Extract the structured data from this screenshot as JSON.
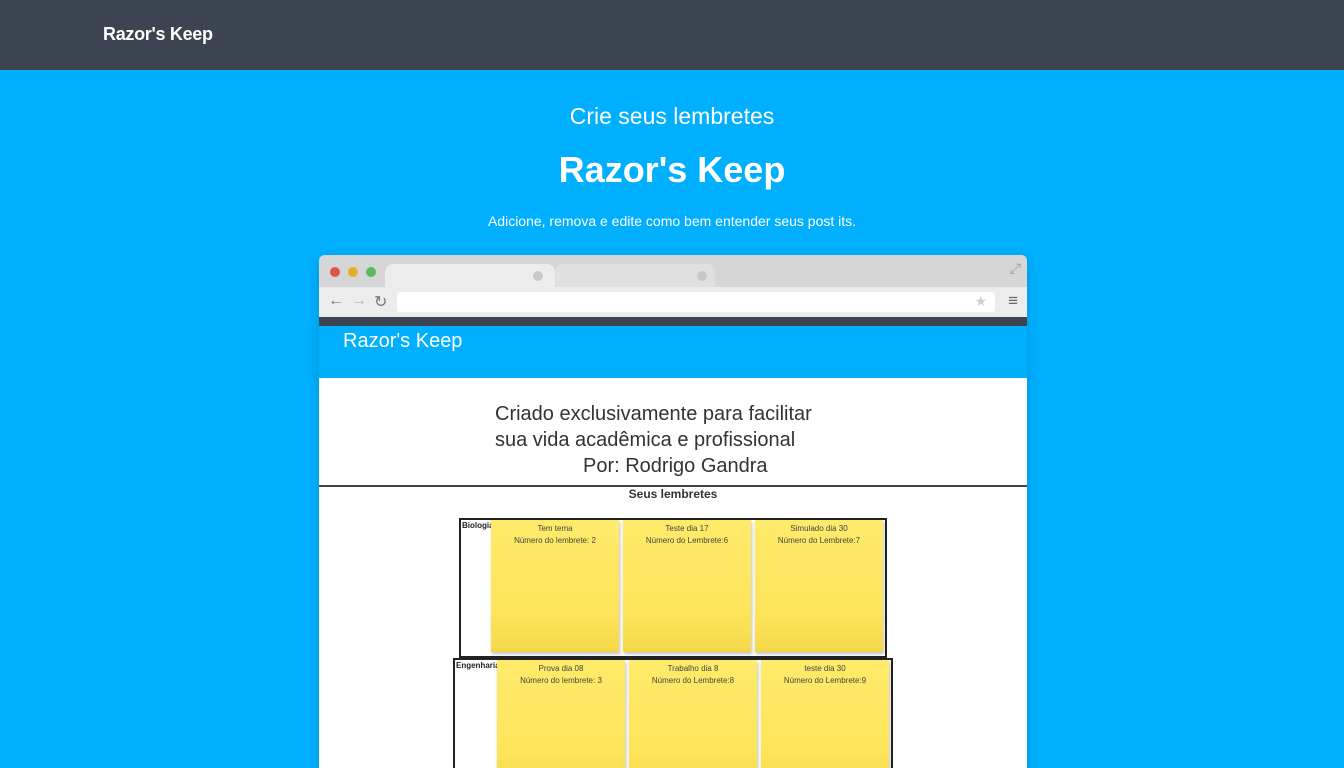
{
  "navbar": {
    "brand": "Razor's Keep"
  },
  "hero": {
    "subtitle": "Crie seus lembretes",
    "title": "Razor's Keep",
    "description": "Adicione, remova e edite como bem entender seus post its."
  },
  "mockup": {
    "app_brand": "Razor's Keep",
    "intro_lines": [
      "Criado exclusivamente para facilitar",
      "sua vida acadêmica e profissional",
      "Por: Rodrigo Gandra"
    ],
    "reminders_title": "Seus lembretes",
    "groups": [
      {
        "label": "Biologia",
        "notes": [
          {
            "title": "Tem tema",
            "number": "Número do lembrete: 2"
          },
          {
            "title": "Teste dia 17",
            "number": "Número do Lembrete:6"
          },
          {
            "title": "Simulado dia 30",
            "number": "Número do Lembrete:7"
          }
        ]
      },
      {
        "label": "Engenharia",
        "notes": [
          {
            "title": "Prova dia 08",
            "number": "Número do lembrete: 3"
          },
          {
            "title": "Trabalho dia 8",
            "number": "Número do Lembrete:8"
          },
          {
            "title": "teste dia 30",
            "number": "Número do Lembrete:9"
          }
        ]
      }
    ]
  },
  "icons": {
    "back": "←",
    "forward": "→",
    "reload": "↻",
    "star": "★",
    "menu": "≡",
    "expand": "⤢"
  },
  "colors": {
    "navbar": "#3b4450",
    "accent": "#00b0ff",
    "note": "#fde45a"
  }
}
